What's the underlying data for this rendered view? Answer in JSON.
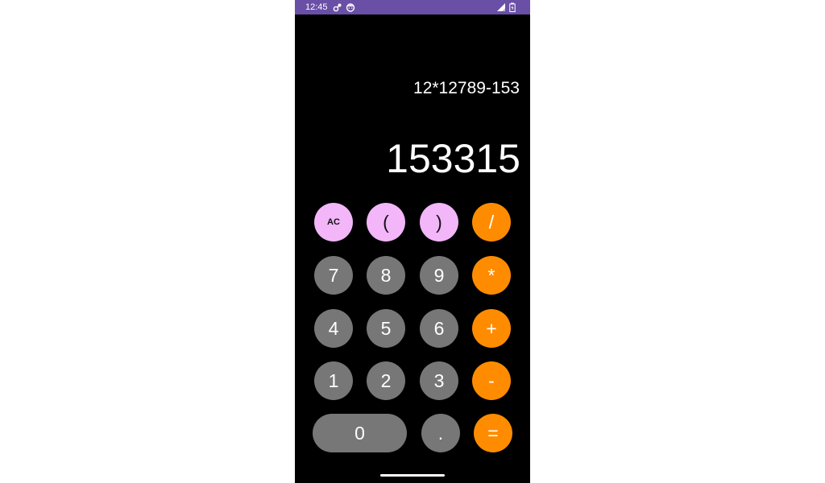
{
  "status_bar": {
    "time": "12:45",
    "color": "#6a4fa6",
    "icons": [
      "settings-icon",
      "face-icon",
      "signal-icon",
      "battery-icon"
    ]
  },
  "display": {
    "expression": "12*12789-153",
    "result": "153315"
  },
  "keypad": {
    "ac": "AC",
    "open_paren": "(",
    "close_paren": ")",
    "divide": "/",
    "seven": "7",
    "eight": "8",
    "nine": "9",
    "multiply": "*",
    "four": "4",
    "five": "5",
    "six": "6",
    "plus": "+",
    "one": "1",
    "two": "2",
    "three": "3",
    "minus": "-",
    "zero": "0",
    "dot": ".",
    "equals": "="
  },
  "colors": {
    "function_button": "#f2b6f9",
    "number_button": "#777777",
    "operator_button": "#ff8c00",
    "background": "#000000"
  }
}
